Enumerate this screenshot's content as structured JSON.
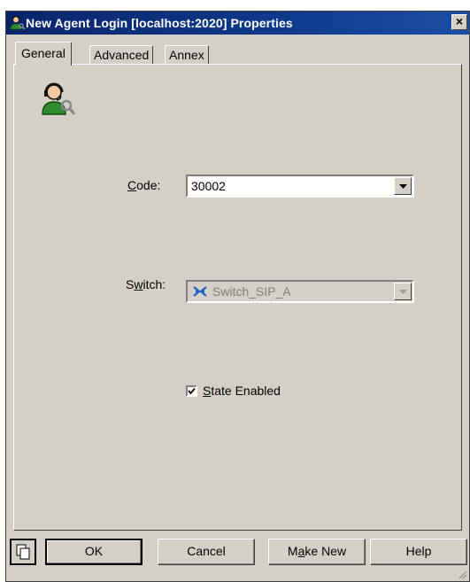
{
  "window": {
    "title": "New Agent Login [localhost:2020] Properties",
    "close_glyph": "×"
  },
  "tabs": [
    {
      "label": "General",
      "active": true
    },
    {
      "label": "Advanced",
      "active": false
    },
    {
      "label": "Annex",
      "active": false
    }
  ],
  "form": {
    "code_label_mnemonic": "C",
    "code_label_rest": "ode:",
    "code_value": "30002",
    "switch_label_pre": "S",
    "switch_label_mnemonic": "w",
    "switch_label_rest": "itch:",
    "switch_value": "Switch_SIP_A",
    "state_label_mnemonic": "S",
    "state_label_rest": "tate Enabled",
    "state_checked": true
  },
  "buttons": {
    "ok": "OK",
    "cancel": "Cancel",
    "make_new_pre": "M",
    "make_new_mnemonic": "a",
    "make_new_rest": "ke New",
    "help": "Help"
  },
  "icons": {
    "title": "agent-login-icon",
    "agent": "agent-headset-icon",
    "switch": "switch-icon",
    "copy": "copy-icon"
  },
  "colors": {
    "title_bar": "#0a246a",
    "dialog_face": "#d4d0c8",
    "agent_green": "#2e8b2e"
  }
}
